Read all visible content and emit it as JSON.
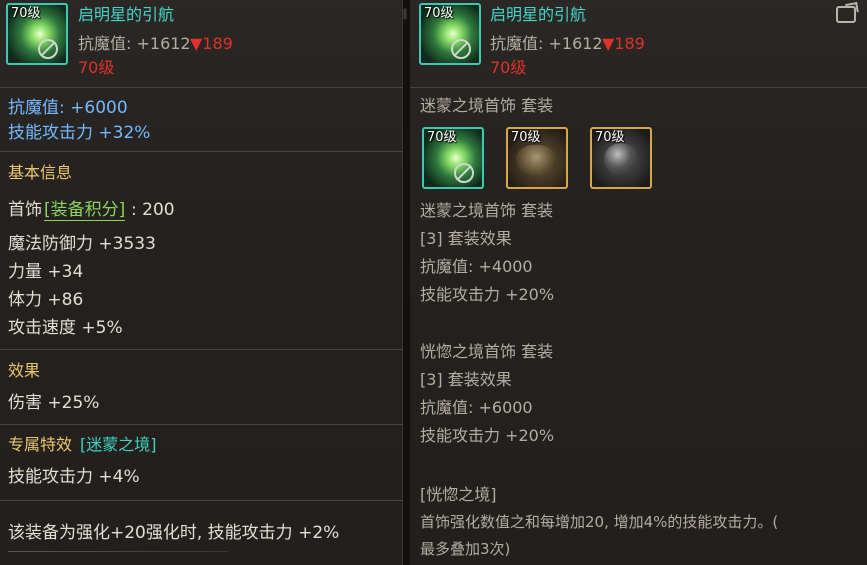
{
  "left": {
    "item": {
      "level_badge": "70级",
      "name": "启明星的引航",
      "stat_label": "抗魔值: +1612",
      "stat_delta": "▼189",
      "level_text": "70级"
    },
    "stats": [
      {
        "text": "抗魔值: +6000",
        "color": "#74b9ff"
      },
      {
        "text": "技能攻击力 +32%",
        "color": "#74b9ff"
      }
    ],
    "basic_info": {
      "heading": "基本信息",
      "slot": "首饰",
      "score_tag": "[装备积分]",
      "score_value": ": 200",
      "lines": [
        "魔法防御力 +3533",
        "力量 +34",
        "体力 +86",
        "攻击速度 +5%"
      ]
    },
    "effect": {
      "heading": "效果",
      "lines": [
        "伤害 +25%"
      ]
    },
    "special": {
      "heading": "专属特效",
      "tag": "[迷蒙之境]",
      "lines": [
        "技能攻击力 +4%"
      ]
    },
    "footer_text": "该装备为强化+20强化时, 技能攻击力 +2%"
  },
  "right": {
    "item": {
      "level_badge": "70级",
      "name": "启明星的引航",
      "stat_label": "抗魔值: +1612",
      "stat_delta": "▼189",
      "level_text": "70级"
    },
    "set_title": "迷蒙之境首饰 套装",
    "set_icons": [
      {
        "label": "70级",
        "icon": "green-orb-icon"
      },
      {
        "label": "70级",
        "icon": "bracelet-icon"
      },
      {
        "label": "70级",
        "icon": "dark-orb-icon"
      }
    ],
    "set_a": {
      "name": "迷蒙之境首饰 套装",
      "effect": "[3] 套装效果",
      "lines": [
        "抗魔值: +4000",
        "技能攻击力 +20%"
      ]
    },
    "set_b": {
      "name": "恍惚之境首饰 套装",
      "effect": "[3] 套装效果",
      "lines": [
        "抗魔值: +6000",
        "技能攻击力 +20%"
      ]
    },
    "special": {
      "tag": "[恍惚之境]",
      "line1": "首饰强化数值之和每增加20, 增加4%的技能攻击力。(",
      "line2": "最多叠加3次)"
    }
  }
}
